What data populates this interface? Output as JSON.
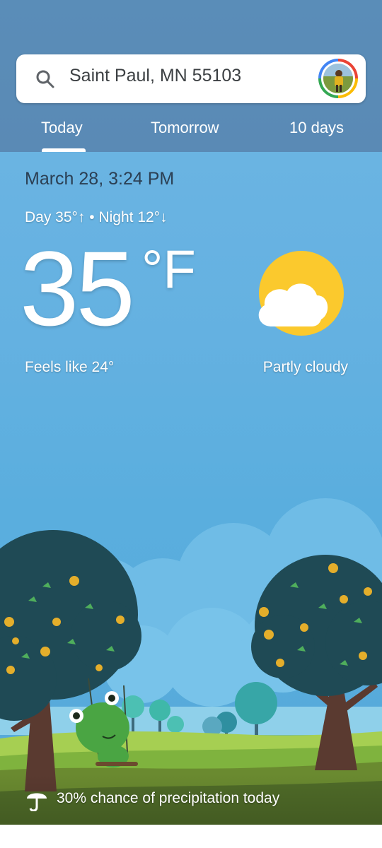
{
  "search": {
    "location": "Saint Paul, MN 55103",
    "icon": "search-icon"
  },
  "account": {
    "avatar_icon": "account-avatar"
  },
  "tabs": [
    {
      "label": "Today",
      "selected": true
    },
    {
      "label": "Tomorrow",
      "selected": false
    },
    {
      "label": "10 days",
      "selected": false
    }
  ],
  "current": {
    "date_time": "March 28, 3:24 PM",
    "day_night": "Day 35°↑ • Night 12°↓",
    "temperature": "35",
    "unit": "°F",
    "feels_like": "Feels like 24°",
    "condition": "Partly cloudy",
    "condition_icon": "partly-cloudy-icon"
  },
  "precipitation": {
    "text": "30% chance of precipitation today",
    "icon": "umbrella-icon"
  },
  "colors": {
    "header_bg": "#5a8bb6",
    "sky": "#64b1e1",
    "sun": "#fbc92d",
    "cloud": "#ffffff"
  }
}
